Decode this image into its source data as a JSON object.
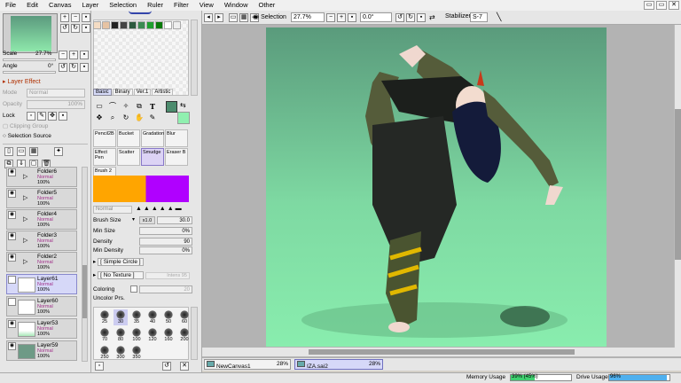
{
  "menu": {
    "items": [
      "File",
      "Edit",
      "Canvas",
      "Layer",
      "Selection",
      "Ruler",
      "Filter",
      "View",
      "Window",
      "Other"
    ]
  },
  "navigator": {
    "scale_label": "Scale",
    "scale_value": "27.7%",
    "angle_label": "Angle",
    "angle_value": "0°"
  },
  "layer_effect": {
    "title": "Layer Effect",
    "mode_label": "Mode",
    "mode_value": "Normal",
    "opacity_label": "Opacity",
    "opacity_value": "100%",
    "lock_label": "Lock",
    "clipping_group": "Clipping Group",
    "selection_source": "Selection Source"
  },
  "layers": [
    {
      "name": "Folder6",
      "blend": "Normal",
      "opacity": "100%"
    },
    {
      "name": "Folder5",
      "blend": "Normal",
      "opacity": "100%"
    },
    {
      "name": "Folder4",
      "blend": "Normal",
      "opacity": "100%"
    },
    {
      "name": "Folder3",
      "blend": "Normal",
      "opacity": "100%"
    },
    {
      "name": "Folder2",
      "blend": "Normal",
      "opacity": "100%"
    },
    {
      "name": "Layer61",
      "blend": "Normal",
      "opacity": "100%"
    },
    {
      "name": "Layer60",
      "blend": "Normal",
      "opacity": "100%"
    },
    {
      "name": "Layer53",
      "blend": "Normal",
      "opacity": "100%"
    },
    {
      "name": "Layer59",
      "blend": "Normal",
      "opacity": "100%"
    }
  ],
  "tool_tabs": [
    "Basic",
    "Binary",
    "Ver.1",
    "Artistic"
  ],
  "brushes": [
    "Pencil2B",
    "Bucket",
    "Gradation",
    "Blur",
    "Effect Pen",
    "Scatter",
    "Smudge",
    "Eraser B",
    "Brush 2"
  ],
  "brush_props": {
    "blend_mode": "Normal",
    "brush_size_label": "Brush Size",
    "brush_size_mult": "x1.0",
    "brush_size_value": "30.0",
    "min_size_label": "Min Size",
    "min_size_value": "0%",
    "density_label": "Density",
    "density_value": "90",
    "min_density_label": "Min Density",
    "min_density_value": "0%",
    "shape": "[ Simple Circle ]",
    "texture": "[ No Texture ]",
    "texture_intensity": "Intens 95",
    "coloring_label": "Coloring",
    "coloring_value": "20",
    "uncolor_label": "Uncolor Prs."
  },
  "brush_sizes": [
    "25",
    "30",
    "35",
    "40",
    "50",
    "60",
    "70",
    "80",
    "100",
    "120",
    "160",
    "200",
    "250",
    "300",
    "350"
  ],
  "toolbar": {
    "selection_label": "Selection",
    "zoom": "27.7%",
    "angle": "0.0°",
    "stabilizer_label": "Stabilizer",
    "stabilizer_value": "S-7"
  },
  "tabs": [
    {
      "name": "NewCanvas1",
      "zoom": "28%"
    },
    {
      "name": "IZA.sai2",
      "zoom": "28%"
    }
  ],
  "status": {
    "memory_label": "Memory Usage",
    "memory_value": "39% (45%)",
    "memory_fraction": 0.39,
    "drive_label": "Drive Usage",
    "drive_value": "96%",
    "drive_fraction": 0.96
  },
  "colors": {
    "primary": "#4a8a6c",
    "swatch_orange": "#ffa500",
    "swatch_purple": "#b000ff",
    "canvas_top": "#5a9b7c",
    "canvas_bottom": "#89edae"
  }
}
